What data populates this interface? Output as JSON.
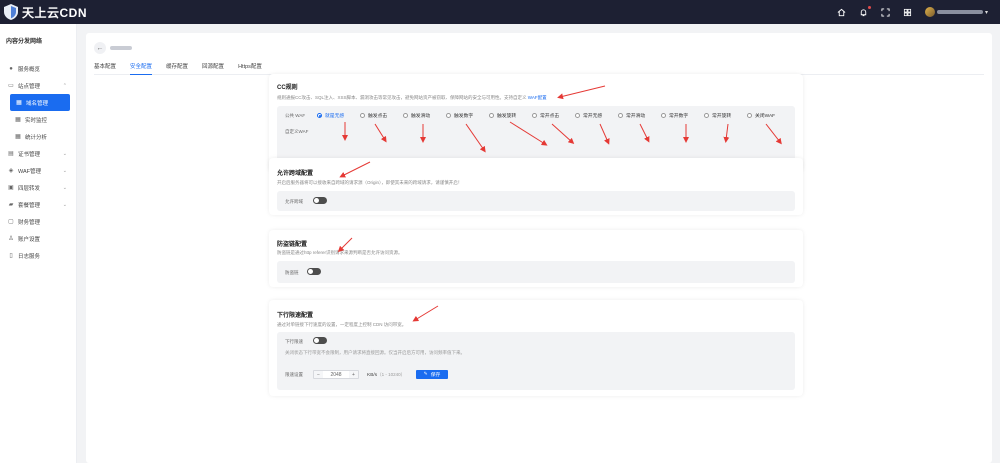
{
  "app": {
    "brand": "天上云CDN"
  },
  "topbar": {
    "icons": [
      "home-icon",
      "bell-icon",
      "fullscreen-icon",
      "grid-icon"
    ],
    "user_caret": "▾"
  },
  "sidebar": {
    "title": "内容分发网络",
    "items": [
      {
        "label": "服务概览",
        "icon": "dot-icon"
      },
      {
        "label": "站点管理",
        "icon": "monitor-icon",
        "arrow": "^"
      },
      {
        "label": "域名管理",
        "icon": "grid-icon",
        "active": true
      },
      {
        "label": "实时监控",
        "icon": "grid-icon"
      },
      {
        "label": "统计分析",
        "icon": "grid-icon"
      },
      {
        "label": "证书管理",
        "icon": "cert-icon",
        "arrow": "v"
      },
      {
        "label": "WAF管理",
        "icon": "shield-icon",
        "arrow": "v"
      },
      {
        "label": "四层转发",
        "icon": "forward-icon",
        "arrow": "v"
      },
      {
        "label": "套餐管理",
        "icon": "package-icon",
        "arrow": "v"
      },
      {
        "label": "财务管理",
        "icon": "finance-icon"
      },
      {
        "label": "账户设置",
        "icon": "user-icon"
      },
      {
        "label": "日志服务",
        "icon": "log-icon"
      }
    ]
  },
  "header": {
    "back": "←"
  },
  "tabs": [
    "基本配置",
    "安全配置",
    "缓存配置",
    "回源配置",
    "Https配置"
  ],
  "cc": {
    "title": "CC规则",
    "desc": "规则通报CC攻击、SQL注入、XSS脚本、漏洞攻击等常见攻击，避免网站资产被窃取、保障网站的安全与可用性。支持自定义",
    "link": "WAF配置",
    "label": "公共 WAF",
    "options": [
      "就是无感",
      "触发点击",
      "触发滑动",
      "触发数字",
      "触发旋转",
      "常开点击",
      "常开无感",
      "常开滑动",
      "常开数字",
      "常开旋转",
      "关闭WAF"
    ],
    "selected": 0,
    "label2": "自定义WAF"
  },
  "cors": {
    "title": "允许跨域配置",
    "desc": "开启后服务器将可以接收来自跨域的请求源（Origin），即使其未来的跨域请求，请谨慎开启！",
    "label": "允许跨域"
  },
  "hotlink": {
    "title": "防盗链配置",
    "desc": "防盗链是通过http referer识别请求来源判断是否允许访问资源。",
    "label": "防盗链"
  },
  "ratelimit": {
    "title": "下行限速配置",
    "desc": "通过对单链接下行速度的设置，一定程度上控制 CDN 访问带宽。",
    "label": "下行限速",
    "hint": "关闭状态下行带宽不会限制，用户请求将直接回源。仅当开启后方可用，访问频率值下来。",
    "speed_label": "限速设置",
    "value": "2048",
    "minus": "−",
    "plus": "+",
    "unit": "KB/s",
    "range": "（1 - 10240）",
    "save": "保存"
  },
  "colors": {
    "accent": "#1a6cf0",
    "topbar": "#1d2033",
    "arrow": "#e53935"
  }
}
